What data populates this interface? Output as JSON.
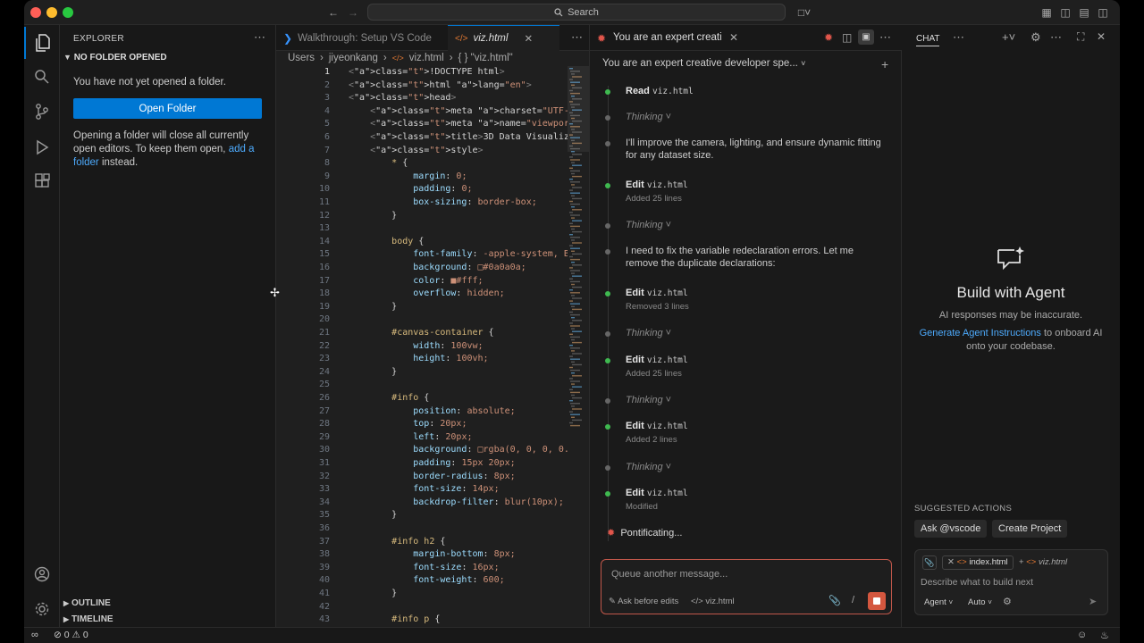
{
  "titlebar": {
    "search": "Search"
  },
  "sidebar": {
    "title": "EXPLORER",
    "section": "NO FOLDER OPENED",
    "message": "You have not yet opened a folder.",
    "open_button": "Open Folder",
    "note_before": "Opening a folder will close all currently open editors. To keep them open, ",
    "note_link": "add a folder",
    "note_after": " instead.",
    "outline": "OUTLINE",
    "timeline": "TIMELINE"
  },
  "editor": {
    "tabs": [
      {
        "label": "Walkthrough: Setup VS Code"
      },
      {
        "label": "viz.html"
      }
    ],
    "breadcrumb": [
      "Users",
      "jiyeonkang",
      "viz.html",
      "{ } \"viz.html\""
    ],
    "lines": [
      {
        "n": "1",
        "code": "<!DOCTYPE html>"
      },
      {
        "n": "2",
        "code": "<html lang=\"en\">"
      },
      {
        "n": "3",
        "code": "<head>"
      },
      {
        "n": "4",
        "code": "    <meta charset=\"UTF-8\">"
      },
      {
        "n": "5",
        "code": "    <meta name=\"viewport\" content=\"width=d"
      },
      {
        "n": "6",
        "code": "    <title>3D Data Visualization</title>"
      },
      {
        "n": "7",
        "code": "    <style>"
      },
      {
        "n": "8",
        "code": "        * {"
      },
      {
        "n": "9",
        "code": "            margin: 0;"
      },
      {
        "n": "10",
        "code": "            padding: 0;"
      },
      {
        "n": "11",
        "code": "            box-sizing: border-box;"
      },
      {
        "n": "12",
        "code": "        }"
      },
      {
        "n": "13",
        "code": ""
      },
      {
        "n": "14",
        "code": "        body {"
      },
      {
        "n": "15",
        "code": "            font-family: -apple-system, Bl"
      },
      {
        "n": "16",
        "code": "            background: □#0a0a0a;"
      },
      {
        "n": "17",
        "code": "            color: ■#fff;"
      },
      {
        "n": "18",
        "code": "            overflow: hidden;"
      },
      {
        "n": "19",
        "code": "        }"
      },
      {
        "n": "20",
        "code": ""
      },
      {
        "n": "21",
        "code": "        #canvas-container {"
      },
      {
        "n": "22",
        "code": "            width: 100vw;"
      },
      {
        "n": "23",
        "code": "            height: 100vh;"
      },
      {
        "n": "24",
        "code": "        }"
      },
      {
        "n": "25",
        "code": ""
      },
      {
        "n": "26",
        "code": "        #info {"
      },
      {
        "n": "27",
        "code": "            position: absolute;"
      },
      {
        "n": "28",
        "code": "            top: 20px;"
      },
      {
        "n": "29",
        "code": "            left: 20px;"
      },
      {
        "n": "30",
        "code": "            background: □rgba(0, 0, 0, 0."
      },
      {
        "n": "31",
        "code": "            padding: 15px 20px;"
      },
      {
        "n": "32",
        "code": "            border-radius: 8px;"
      },
      {
        "n": "33",
        "code": "            font-size: 14px;"
      },
      {
        "n": "34",
        "code": "            backdrop-filter: blur(10px);"
      },
      {
        "n": "35",
        "code": "        }"
      },
      {
        "n": "36",
        "code": ""
      },
      {
        "n": "37",
        "code": "        #info h2 {"
      },
      {
        "n": "38",
        "code": "            margin-bottom: 8px;"
      },
      {
        "n": "39",
        "code": "            font-size: 16px;"
      },
      {
        "n": "40",
        "code": "            font-weight: 600;"
      },
      {
        "n": "41",
        "code": "        }"
      },
      {
        "n": "42",
        "code": ""
      },
      {
        "n": "43",
        "code": "        #info p {"
      }
    ]
  },
  "chat_panel": {
    "tab_label": "You are an expert creati",
    "header": "You are an expert creative developer spe...",
    "steps": [
      {
        "kind": "action",
        "label": "Read",
        "file": "viz.html",
        "sub": ""
      },
      {
        "kind": "thinking",
        "label": "Thinking"
      },
      {
        "kind": "message",
        "text": "I'll improve the camera, lighting, and ensure dynamic fitting",
        "text2": "for any dataset size."
      },
      {
        "kind": "action",
        "label": "Edit",
        "file": "viz.html",
        "sub": "Added 25 lines"
      },
      {
        "kind": "thinking",
        "label": "Thinking"
      },
      {
        "kind": "message",
        "text": "I need to fix the variable redeclaration errors. Let me",
        "text2": "remove the duplicate declarations:"
      },
      {
        "kind": "action",
        "label": "Edit",
        "file": "viz.html",
        "sub": "Removed 3 lines"
      },
      {
        "kind": "thinking",
        "label": "Thinking"
      },
      {
        "kind": "action",
        "label": "Edit",
        "file": "viz.html",
        "sub": "Added 25 lines"
      },
      {
        "kind": "thinking",
        "label": "Thinking"
      },
      {
        "kind": "action",
        "label": "Edit",
        "file": "viz.html",
        "sub": "Added 2 lines"
      },
      {
        "kind": "thinking",
        "label": "Thinking"
      },
      {
        "kind": "action",
        "label": "Edit",
        "file": "viz.html",
        "sub": "Modified"
      }
    ],
    "status": "Pontificating...",
    "queue_placeholder": "Queue another message...",
    "ask_before_edits": "Ask before edits",
    "context_file": "viz.html"
  },
  "right_chat": {
    "title": "CHAT",
    "build_title": "Build with Agent",
    "build_sub": "AI responses may be inaccurate.",
    "gen_link": "Generate Agent Instructions",
    "gen_after": " to onboard AI onto your codebase.",
    "suggested_title": "SUGGESTED ACTIONS",
    "suggested": [
      "Ask @vscode",
      "Create Project"
    ],
    "chips": [
      "index.html",
      "viz.html"
    ],
    "input_placeholder": "Describe what to build next",
    "mode": "Agent",
    "model": "Auto"
  },
  "statusbar": {
    "errors": "0",
    "warnings": "0"
  },
  "colors": {
    "accent": "#0078d4",
    "link": "#4daafc",
    "chat_accent": "#e2564b",
    "green_dot": "#3fb950"
  }
}
